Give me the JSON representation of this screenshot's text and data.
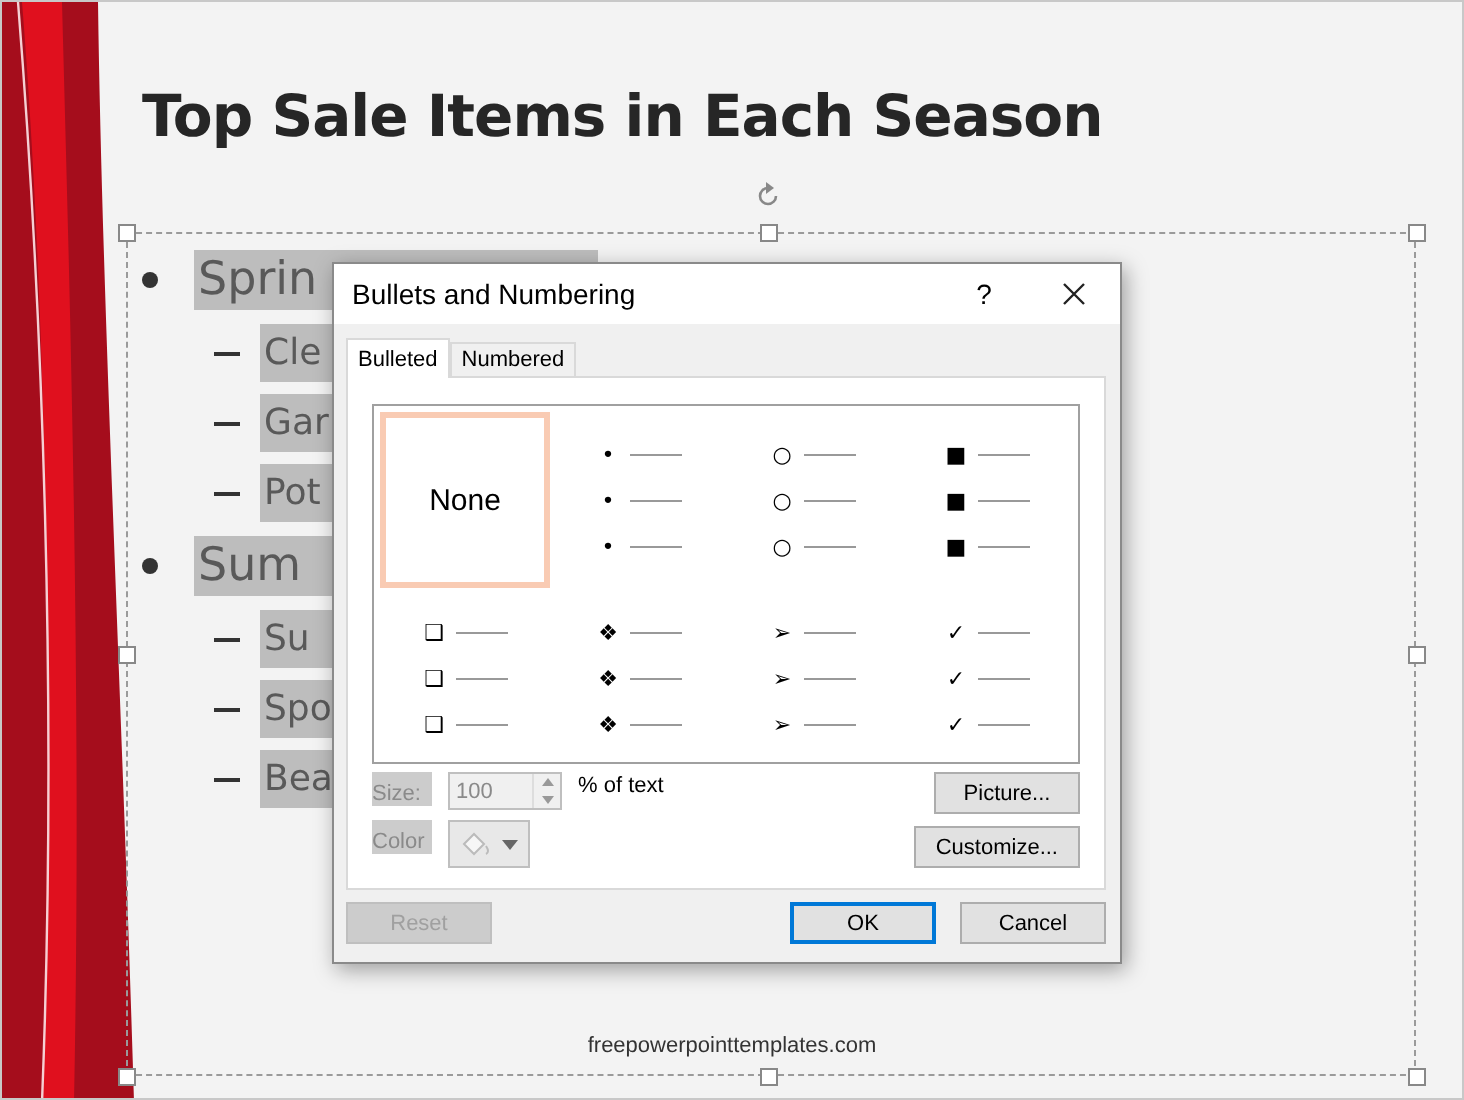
{
  "slide": {
    "title": "Top Sale Items in Each Season",
    "items": [
      {
        "text": "Sprin",
        "selected": true,
        "children": [
          {
            "text": "Cle",
            "selected": true
          },
          {
            "text": "Gar",
            "selected": true
          },
          {
            "text": "Pot",
            "selected": true
          }
        ]
      },
      {
        "text": "Sum",
        "selected": true,
        "children": [
          {
            "text": "Su",
            "selected": true
          },
          {
            "text": "Spo",
            "selected": true
          },
          {
            "text": "Bea",
            "selected": true
          }
        ]
      }
    ],
    "footer": "freepowerpointtemplates.com"
  },
  "dialog": {
    "title": "Bullets and Numbering",
    "help": "?",
    "tabs": [
      {
        "label": "Bulleted",
        "selected": true
      },
      {
        "label": "Numbered",
        "selected": false
      }
    ],
    "gallery": [
      {
        "kind": "none",
        "label": "None",
        "selected": true
      },
      {
        "kind": "bullet",
        "bullets": [
          "•",
          "•",
          "•"
        ],
        "selected": false
      },
      {
        "kind": "bullet",
        "bullets": [
          "○",
          "○",
          "○"
        ],
        "selected": false
      },
      {
        "kind": "bullet",
        "bullets": [
          "■",
          "■",
          "■"
        ],
        "selected": false
      },
      {
        "kind": "bullet",
        "bullets": [
          "❑",
          "❑",
          "❑"
        ],
        "selected": false
      },
      {
        "kind": "bullet",
        "bullets": [
          "❖",
          "❖",
          "❖"
        ],
        "selected": false
      },
      {
        "kind": "bullet",
        "bullets": [
          "➢",
          "➢",
          "➢"
        ],
        "selected": false
      },
      {
        "kind": "bullet",
        "bullets": [
          "✓",
          "✓",
          "✓"
        ],
        "selected": false
      }
    ],
    "size": {
      "label": "Size:",
      "value": "100",
      "disabled": true,
      "unit": "% of text"
    },
    "color": {
      "label": "Color",
      "disabled": true
    },
    "side_buttons": [
      "Picture...",
      "Customize..."
    ],
    "buttons": [
      {
        "label": "Reset",
        "disabled": true,
        "default": false
      },
      {
        "label": "OK",
        "disabled": false,
        "default": true
      },
      {
        "label": "Cancel",
        "disabled": false,
        "default": false
      }
    ]
  }
}
